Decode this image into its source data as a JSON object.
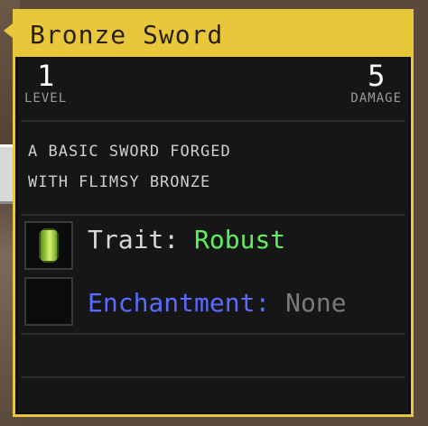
{
  "item": {
    "name": "Bronze Sword",
    "level_value": "1",
    "level_label": "LEVEL",
    "damage_value": "5",
    "damage_label": "DAMAGE",
    "description_line1": "A BASIC SWORD FORGED",
    "description_line2": "WITH FLIMSY BRONZE"
  },
  "trait": {
    "label": "Trait:",
    "value": "Robust",
    "icon": "green-gem-icon"
  },
  "enchantment": {
    "label": "Enchantment:",
    "value": "None"
  },
  "colors": {
    "border": "#e8c83a",
    "trait_value": "#5ef05e",
    "enchantment_label": "#5c6bff",
    "enchantment_value": "#7a7a7a"
  }
}
